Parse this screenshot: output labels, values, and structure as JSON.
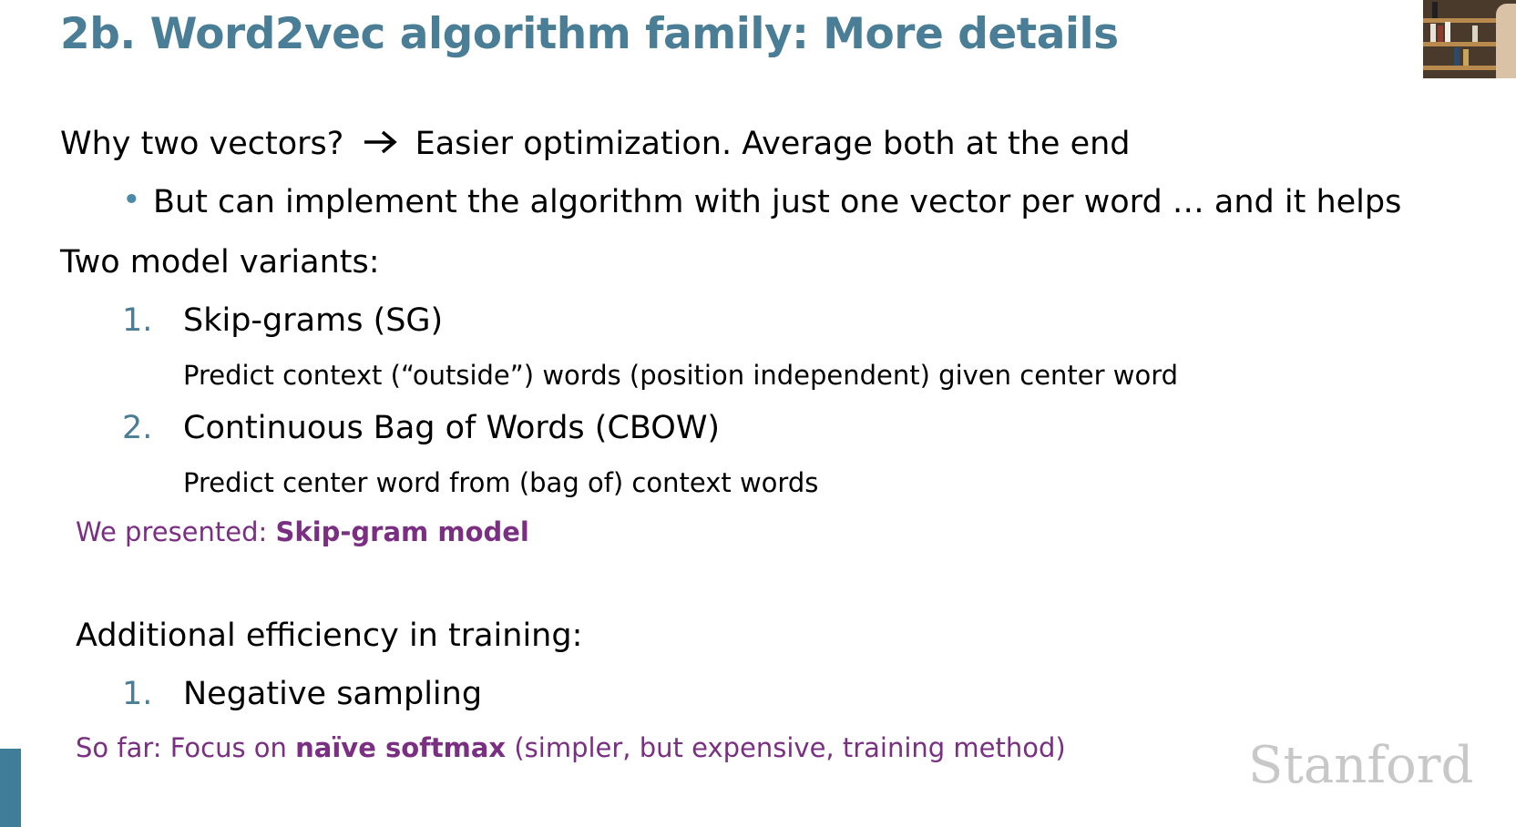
{
  "colors": {
    "title": "#4a7d96",
    "bullet": "#4a8aa8",
    "number": "#4a7d96",
    "note": "#7a2f82",
    "accent_bar": "#3f7d99",
    "logo": "#c8c8c8"
  },
  "slide": {
    "title": "2b. Word2vec algorithm family: More details",
    "why_line": {
      "question": "Why two vectors?",
      "arrow_icon": "right-arrow-icon",
      "answer": "Easier optimization. Average both at the end"
    },
    "bullet": "But can implement the algorithm with just one vector per word … and it helps",
    "variants_heading": "Two model variants:",
    "variants": [
      {
        "number": "1.",
        "name": "Skip-grams (SG)",
        "description": "Predict context (“outside”) words (position independent) given center word"
      },
      {
        "number": "2.",
        "name": "Continuous Bag of Words (CBOW)",
        "description": "Predict center word from (bag of) context words"
      }
    ],
    "presented_note": {
      "prefix": "We presented: ",
      "bold": "Skip-gram model"
    },
    "efficiency_heading": "Additional efficiency in training:",
    "efficiency_items": [
      {
        "number": "1.",
        "name": "Negative sampling"
      }
    ],
    "sofar_note": {
      "prefix": "So far: Focus on ",
      "bold": "naïve softmax",
      "suffix": " (simpler, but expensive, training method)"
    },
    "logo": "Stanford"
  }
}
